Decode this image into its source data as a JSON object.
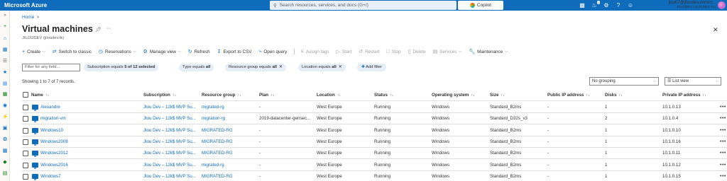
{
  "topbar": {
    "brand": "Microsoft Azure",
    "search_placeholder": "Search resources, services, and docs (G+/)",
    "copilot_label": "Copilot",
    "notification_count": "1",
    "account_email": "jlou07@jlloudev.onmicr...",
    "account_tenant": "JILOUDEV (JILOUDEV.TK)"
  },
  "breadcrumb": {
    "home": "Home",
    "sep": ">"
  },
  "page": {
    "title": "Virtual machines",
    "subtitle": "JILOUDEV (jiloudev.tk)"
  },
  "commands": {
    "create": "Create",
    "switch_classic": "Switch to classic",
    "reservations": "Reservations",
    "manage_view": "Manage view",
    "refresh": "Refresh",
    "export_csv": "Export to CSV",
    "open_query": "Open query",
    "assign_tags": "Assign tags",
    "start": "Start",
    "restart": "Restart",
    "stop": "Stop",
    "delete": "Delete",
    "services": "Services",
    "maintenance": "Maintenance"
  },
  "filters": {
    "placeholder": "Filter for any field...",
    "subscription_prefix": "Subscription equals ",
    "subscription_value": "5 of 12 selected",
    "type_prefix": "Type equals ",
    "type_value": "all",
    "rg_prefix": "Resource group equals ",
    "rg_value": "all",
    "location_prefix": "Location equals ",
    "location_value": "all",
    "add_filter": "Add filter"
  },
  "records_text": "Showing 1 to 7 of 7 records.",
  "grouping": "No grouping",
  "view": "List view",
  "table": {
    "columns": [
      "Name",
      "Subscription",
      "Resource group",
      "Plan",
      "Location",
      "Status",
      "Operating system",
      "Size",
      "Public IP address",
      "Disks",
      "Private IP address"
    ],
    "rows": [
      [
        "Alexandre",
        "Jlou Dev – 12k$ MVP Su...",
        "migrated-rg",
        "-",
        "West Europe",
        "Running",
        "Windows",
        "Standard_B2ms",
        "-",
        "1",
        "10.1.0.13"
      ],
      [
        "migration-vm",
        "Jlou Dev – 12k$ MVP Su...",
        "migration-rg",
        "2019-datacenter-gensec...",
        "West Europe",
        "Running",
        "Windows",
        "Standard_D32s_v3",
        "-",
        "2",
        "10.1.0.4"
      ],
      [
        "Windows10",
        "Jlou Dev – 12k$ MVP Su...",
        "MIGRATED-RG",
        "-",
        "West Europe",
        "Running",
        "Windows",
        "Standard_B2ms",
        "-",
        "1",
        "10.1.0.10"
      ],
      [
        "Windows2008",
        "Jlou Dev – 12k$ MVP Su...",
        "MIGRATED-RG",
        "-",
        "West Europe",
        "Running",
        "Windows",
        "Standard_B2ms",
        "-",
        "1",
        "10.1.0.16"
      ],
      [
        "Windows2012",
        "Jlou Dev – 12k$ MVP Su...",
        "MIGRATED-RG",
        "-",
        "West Europe",
        "Running",
        "Windows",
        "Standard_B2ms",
        "-",
        "1",
        "10.1.0.11"
      ],
      [
        "Windows2016",
        "Jlou Dev – 12k$ MVP Su...",
        "migrated-rg",
        "-",
        "West Europe",
        "Running",
        "Windows",
        "Standard_B2ms",
        "-",
        "1",
        "10.1.0.12"
      ],
      [
        "Windows7",
        "Jlou Dev – 12k$ MVP Su...",
        "MIGRATED-RG",
        "-",
        "West Europe",
        "Running",
        "Windows",
        "Standard_B2ms",
        "-",
        "1",
        "10.1.0.15"
      ]
    ],
    "row_more": "•••"
  },
  "colors": {
    "accent": "#0f6cbd",
    "pill": "#e5edf7"
  }
}
